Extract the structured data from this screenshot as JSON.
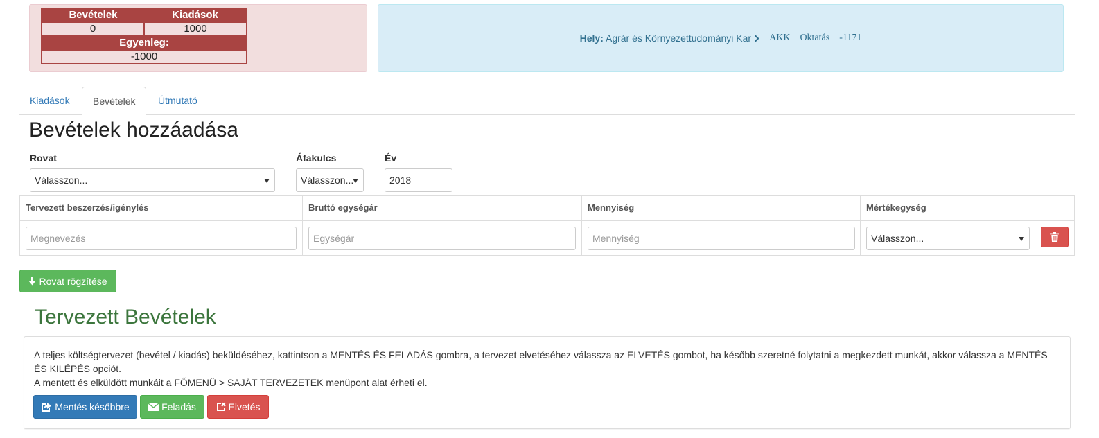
{
  "summary": {
    "income_header": "Bevételek",
    "expense_header": "Kiadások",
    "income_value": "0",
    "expense_value": "1000",
    "balance_header": "Egyenleg:",
    "balance_value": "-1000"
  },
  "location": {
    "label": "Hely:",
    "faculty": "Agrár és Környezettudományi Kar",
    "unit": "AKK",
    "category": "Oktatás",
    "code": "-1171"
  },
  "tabs": [
    {
      "label": "Kiadások",
      "active": false
    },
    {
      "label": "Bevételek",
      "active": true
    },
    {
      "label": "Útmutató",
      "active": false
    }
  ],
  "form": {
    "title": "Bevételek hozzáadása",
    "rovat_label": "Rovat",
    "rovat_value": "Válasszon...",
    "vat_label": "Áfakulcs",
    "vat_value": "Válasszon...",
    "year_label": "Év",
    "year_value": "2018"
  },
  "items": {
    "headers": [
      "Tervezett beszerzés/igénylés",
      "Bruttó egységár",
      "Mennyiség",
      "Mértékegység"
    ],
    "name_placeholder": "Megnevezés",
    "price_placeholder": "Egységár",
    "quantity_placeholder": "Mennyiség",
    "unit_value": "Válasszon..."
  },
  "buttons": {
    "save_rovat": "Rovat rögzítése",
    "save_later": "Mentés későbbre",
    "submit": "Feladás",
    "discard": "Elvetés"
  },
  "planned": {
    "title": "Tervezett Bevételek",
    "info_line1": "A teljes költségtervezet (bevétel / kiadás) beküldéséhez, kattintson a MENTÉS ÉS FELADÁS gombra, a tervezet elvetéséhez válassza az ELVETÉS gombot, ha később szeretné folytatni a megkezdett munkát, akkor válassza a MENTÉS ÉS KILÉPÉS opciót.",
    "info_line2": "A mentett és elküldött munkáit a FŐMENÜ > SAJÁT TERVEZETEK menüpont alat érheti el."
  },
  "colors": {
    "danger": "#a94442",
    "info": "#31708f",
    "success": "#5cb85c",
    "primary": "#337ab7",
    "link": "#337ab7"
  },
  "icons": [
    "chevron-right-icon",
    "trash-icon",
    "arrow-down-icon",
    "share-icon",
    "envelope-icon",
    "remove-icon"
  ]
}
